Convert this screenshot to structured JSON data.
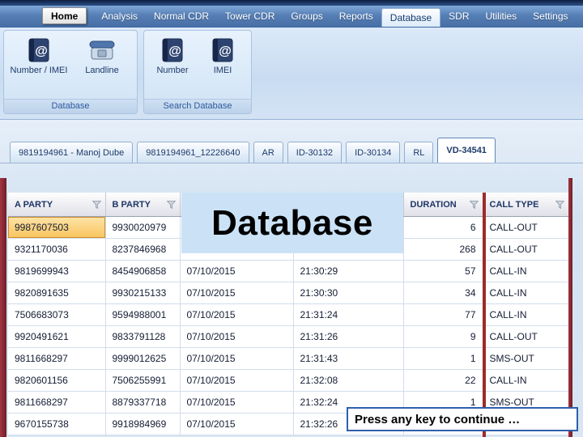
{
  "ribbon": {
    "tabs": [
      "Home",
      "Analysis",
      "Normal CDR",
      "Tower CDR",
      "Groups",
      "Reports",
      "Database",
      "SDR",
      "Utilities",
      "Settings"
    ],
    "groups": {
      "database": {
        "label": "Database",
        "buttons": {
          "number_imei": "Number / IMEI",
          "landline": "Landline"
        }
      },
      "search": {
        "label": "Search Database",
        "buttons": {
          "number": "Number",
          "imei": "IMEI"
        }
      }
    }
  },
  "document_tabs": [
    "9819194961 - Manoj Dube",
    "9819194961_12226640",
    "AR",
    "ID-30132",
    "ID-30134",
    "RL",
    "VD-34541"
  ],
  "table": {
    "columns": [
      "A PARTY",
      "B PARTY",
      "",
      "",
      "DURATION",
      "CALL TYPE"
    ],
    "rows": [
      [
        "9987607503",
        "9930020979",
        "",
        "",
        "6",
        "CALL-OUT"
      ],
      [
        "9321170036",
        "8237846968",
        "",
        "",
        "268",
        "CALL-OUT"
      ],
      [
        "9819699943",
        "8454906858",
        "07/10/2015",
        "21:30:29",
        "57",
        "CALL-IN"
      ],
      [
        "9820891635",
        "9930215133",
        "07/10/2015",
        "21:30:30",
        "34",
        "CALL-IN"
      ],
      [
        "7506683073",
        "9594988001",
        "07/10/2015",
        "21:31:24",
        "77",
        "CALL-IN"
      ],
      [
        "9920491621",
        "9833791128",
        "07/10/2015",
        "21:31:26",
        "9",
        "CALL-OUT"
      ],
      [
        "9811668297",
        "9999012625",
        "07/10/2015",
        "21:31:43",
        "1",
        "SMS-OUT"
      ],
      [
        "9820601156",
        "7506255991",
        "07/10/2015",
        "21:32:08",
        "22",
        "CALL-IN"
      ],
      [
        "9811668297",
        "8879337718",
        "07/10/2015",
        "21:32:24",
        "1",
        "SMS-OUT"
      ],
      [
        "9670155738",
        "9918984969",
        "07/10/2015",
        "21:32:26",
        "",
        ""
      ]
    ]
  },
  "overlays": {
    "slide_title": "Database",
    "continue_prompt": "Press any key to continue …"
  },
  "icons": {
    "address_book_glyph": "@"
  },
  "colors": {
    "accent_red": "#9e2b2b",
    "selected_cell": "#f9c35d",
    "ribbon_blue": "#4a78b4",
    "overlay_blue": "#cbe2f6",
    "prompt_border": "#2e5fae"
  }
}
